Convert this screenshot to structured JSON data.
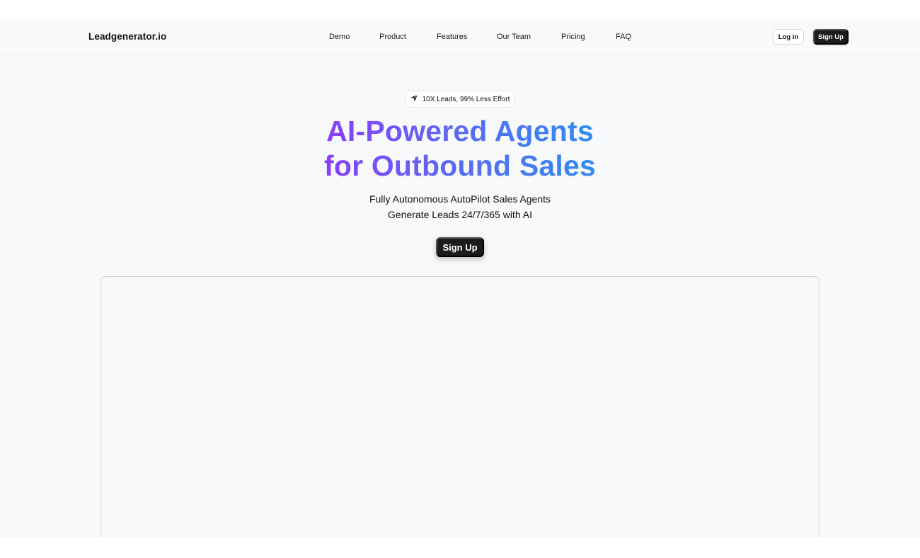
{
  "brand": {
    "name": "Leadgenerator.io"
  },
  "nav": {
    "links": [
      "Demo",
      "Product",
      "Features",
      "Our Team",
      "Pricing",
      "FAQ"
    ],
    "login_label": "Log in",
    "signup_label": "Sign Up"
  },
  "hero": {
    "badge_icon": "paper-plane-icon",
    "badge_text": "10X Leads, 99% Less Effort",
    "title_line1": "AI-Powered Agents",
    "title_line2": "for Outbound Sales",
    "subtitle_line1": "Fully Autonomous AutoPilot Sales Agents",
    "subtitle_line2": "Generate Leads 24/7/365 with AI",
    "cta_label": "Sign Up",
    "gradient_start": "#8a3ffc",
    "gradient_end": "#2f8cf0"
  },
  "colors": {
    "page_background": "#f8f9fa",
    "primary_button": "#1c1c1e"
  }
}
